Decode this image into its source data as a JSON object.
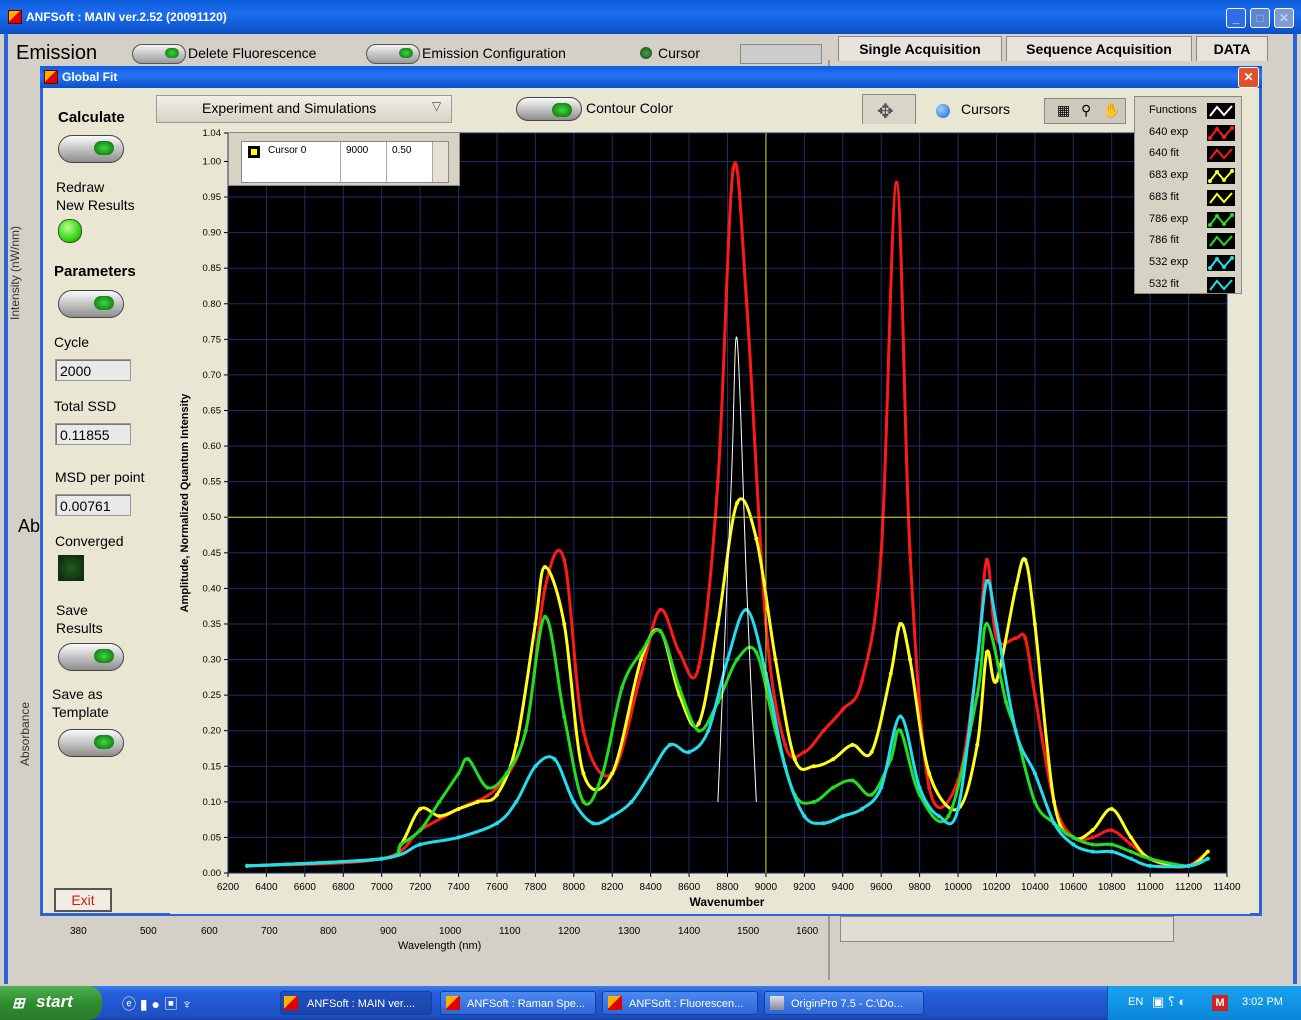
{
  "window": {
    "title": "ANFSoft : MAIN ver.2.52 (20091120)"
  },
  "main": {
    "emission_label": "Emission",
    "delete_fluorescence": "Delete Fluorescence",
    "emission_configuration": "Emission Configuration",
    "cursor_label": "Cursor",
    "tabs": [
      "Single Acquisition",
      "Sequence Acquisition",
      "DATA"
    ],
    "intensity_axis": "Intensity (nW/nm)",
    "absorbance_axis": "Absorbance",
    "ab_label": "Ab",
    "wavelength_label": "Wavelength (nm)",
    "wavelength_ticks": [
      "380",
      "500",
      "600",
      "700",
      "800",
      "900",
      "1000",
      "1100",
      "1200",
      "1300",
      "1400",
      "1500",
      "1600"
    ]
  },
  "dialog": {
    "title": "Global Fit",
    "calculate": "Calculate",
    "redraw": "Redraw\nNew Results",
    "parameters": "Parameters",
    "cycle_label": "Cycle",
    "cycle_value": "2000",
    "ssd_label": "Total SSD",
    "ssd_value": "0.11855",
    "msd_label": "MSD per point",
    "msd_value": "0.00761",
    "converged_label": "Converged",
    "save_results": "Save\nResults",
    "save_template": "Save as\nTemplate",
    "exit": "Exit",
    "experiment_dropdown": "Experiment and Simulations",
    "contour_color": "Contour Color",
    "cursors_label": "Cursors",
    "cursor_table": {
      "name": "Cursor 0",
      "x": "9000",
      "y": "0.50"
    }
  },
  "legend": [
    {
      "label": "Functions",
      "color": "#ffffff",
      "kind": "fit"
    },
    {
      "label": "640 exp",
      "color": "#ff1a1a",
      "kind": "exp"
    },
    {
      "label": "640 fit",
      "color": "#ff1a1a",
      "kind": "fit"
    },
    {
      "label": "683 exp",
      "color": "#ffff1a",
      "kind": "exp"
    },
    {
      "label": "683 fit",
      "color": "#ffff1a",
      "kind": "fit"
    },
    {
      "label": "786 exp",
      "color": "#22dd22",
      "kind": "exp"
    },
    {
      "label": "786 fit",
      "color": "#22dd22",
      "kind": "fit"
    },
    {
      "label": "532 exp",
      "color": "#22ddee",
      "kind": "exp"
    },
    {
      "label": "532 fit",
      "color": "#22ddee",
      "kind": "fit"
    }
  ],
  "chart_data": {
    "type": "line",
    "xlabel": "Wavenumber",
    "ylabel": "Amplitude, Normalized Quantum Intensity",
    "xlim": [
      6200,
      11400
    ],
    "ylim": [
      0,
      1.04
    ],
    "xticks": [
      6200,
      6400,
      6600,
      6800,
      7000,
      7200,
      7400,
      7600,
      7800,
      8000,
      8200,
      8400,
      8600,
      8800,
      9000,
      9200,
      9400,
      9600,
      9800,
      10000,
      10200,
      10400,
      10600,
      10800,
      11000,
      11200,
      11400
    ],
    "yticks": [
      0.0,
      0.05,
      0.1,
      0.15,
      0.2,
      0.25,
      0.3,
      0.35,
      0.4,
      0.45,
      0.5,
      0.55,
      0.6,
      0.65,
      0.7,
      0.75,
      0.8,
      0.85,
      0.9,
      0.95,
      1.0,
      1.04
    ],
    "grid": true,
    "legend_position": "top-right",
    "cursor": {
      "x": 9000,
      "y": 0.5
    },
    "series": [
      {
        "name": "640 exp",
        "color": "#ff1a1a",
        "x": [
          6300,
          7000,
          7200,
          7400,
          7600,
          7750,
          7850,
          7950,
          8050,
          8200,
          8350,
          8450,
          8550,
          8650,
          8750,
          8830,
          8900,
          9000,
          9100,
          9200,
          9300,
          9400,
          9500,
          9600,
          9680,
          9750,
          9850,
          10000,
          10100,
          10150,
          10200,
          10300,
          10350,
          10400,
          10500,
          10600,
          10700,
          10800,
          10900,
          11000,
          11100,
          11200,
          11300
        ],
        "y": [
          0.01,
          0.02,
          0.06,
          0.09,
          0.12,
          0.2,
          0.4,
          0.44,
          0.2,
          0.14,
          0.28,
          0.37,
          0.31,
          0.29,
          0.55,
          0.99,
          0.8,
          0.35,
          0.18,
          0.17,
          0.2,
          0.23,
          0.27,
          0.45,
          0.97,
          0.45,
          0.12,
          0.13,
          0.3,
          0.44,
          0.33,
          0.33,
          0.33,
          0.25,
          0.1,
          0.05,
          0.05,
          0.06,
          0.04,
          0.02,
          0.01,
          0.01,
          0.03
        ]
      },
      {
        "name": "683 exp",
        "color": "#ffff1a",
        "x": [
          6300,
          7000,
          7100,
          7200,
          7300,
          7400,
          7500,
          7600,
          7700,
          7800,
          7850,
          7950,
          8050,
          8200,
          8350,
          8450,
          8550,
          8650,
          8750,
          8850,
          8950,
          9050,
          9150,
          9250,
          9350,
          9450,
          9550,
          9650,
          9700,
          9750,
          9850,
          10000,
          10100,
          10150,
          10200,
          10300,
          10350,
          10400,
          10500,
          10600,
          10700,
          10800,
          10900,
          11000,
          11200,
          11300
        ],
        "y": [
          0.01,
          0.02,
          0.04,
          0.09,
          0.08,
          0.09,
          0.1,
          0.11,
          0.18,
          0.35,
          0.43,
          0.35,
          0.14,
          0.14,
          0.3,
          0.34,
          0.25,
          0.21,
          0.35,
          0.52,
          0.47,
          0.3,
          0.16,
          0.15,
          0.16,
          0.18,
          0.17,
          0.28,
          0.35,
          0.3,
          0.14,
          0.09,
          0.18,
          0.31,
          0.27,
          0.4,
          0.44,
          0.35,
          0.1,
          0.05,
          0.06,
          0.09,
          0.05,
          0.02,
          0.01,
          0.03
        ]
      },
      {
        "name": "786 exp",
        "color": "#22dd22",
        "x": [
          6300,
          7000,
          7100,
          7200,
          7300,
          7400,
          7450,
          7550,
          7650,
          7750,
          7850,
          7950,
          8050,
          8150,
          8250,
          8350,
          8450,
          8550,
          8650,
          8750,
          8850,
          8950,
          9050,
          9150,
          9250,
          9350,
          9450,
          9550,
          9650,
          9700,
          9800,
          9950,
          10100,
          10150,
          10250,
          10300,
          10400,
          10500,
          10600,
          10700,
          10800,
          10900,
          11000,
          11200,
          11300
        ],
        "y": [
          0.01,
          0.02,
          0.04,
          0.06,
          0.1,
          0.14,
          0.16,
          0.12,
          0.14,
          0.2,
          0.36,
          0.22,
          0.1,
          0.14,
          0.26,
          0.31,
          0.34,
          0.26,
          0.2,
          0.24,
          0.3,
          0.31,
          0.2,
          0.11,
          0.1,
          0.12,
          0.13,
          0.11,
          0.16,
          0.2,
          0.11,
          0.08,
          0.25,
          0.35,
          0.24,
          0.2,
          0.1,
          0.07,
          0.05,
          0.04,
          0.04,
          0.03,
          0.02,
          0.01,
          0.02
        ]
      },
      {
        "name": "532 exp",
        "color": "#22ddee",
        "x": [
          6300,
          7000,
          7200,
          7400,
          7600,
          7700,
          7800,
          7900,
          8000,
          8100,
          8200,
          8300,
          8400,
          8500,
          8600,
          8700,
          8800,
          8900,
          9000,
          9100,
          9200,
          9300,
          9400,
          9500,
          9600,
          9700,
          9800,
          9900,
          10000,
          10100,
          10150,
          10200,
          10300,
          10400,
          10500,
          10600,
          10700,
          10800,
          10900,
          11000,
          11200,
          11300
        ],
        "y": [
          0.01,
          0.02,
          0.04,
          0.05,
          0.07,
          0.1,
          0.15,
          0.16,
          0.1,
          0.07,
          0.08,
          0.1,
          0.14,
          0.18,
          0.17,
          0.2,
          0.3,
          0.37,
          0.28,
          0.15,
          0.08,
          0.07,
          0.08,
          0.09,
          0.12,
          0.22,
          0.12,
          0.08,
          0.09,
          0.3,
          0.41,
          0.35,
          0.2,
          0.14,
          0.07,
          0.04,
          0.03,
          0.03,
          0.02,
          0.01,
          0.01,
          0.02
        ]
      },
      {
        "name": "Functions",
        "color": "#ffffff",
        "x": [
          8750,
          8820,
          8850,
          8900,
          8950
        ],
        "y": [
          0.1,
          0.55,
          0.75,
          0.4,
          0.1
        ]
      }
    ]
  },
  "taskbar": {
    "start": "start",
    "items": [
      "ANFSoft : MAIN ver....",
      "ANFSoft : Raman Spe...",
      "ANFSoft : Fluorescen...",
      "OriginPro 7.5 - C:\\Do..."
    ],
    "lang": "EN",
    "time": "3:02 PM"
  }
}
